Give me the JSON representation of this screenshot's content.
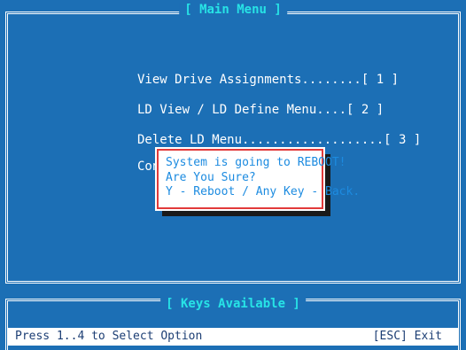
{
  "main_menu": {
    "title": "[ Main Menu ]",
    "items": [
      {
        "label": "View Drive Assignments........[ 1 ]"
      },
      {
        "label": "LD View / LD Define Menu....[ 2 ]"
      },
      {
        "label": "Delete LD Menu...................[ 3 ]"
      },
      {
        "label": "Con"
      }
    ]
  },
  "dialog": {
    "line1": "System is going to REBOOT!",
    "line2": "Are You Sure?",
    "line3": "Y - Reboot / Any Key - Back."
  },
  "keys_panel": {
    "title": "[ Keys Available ]"
  },
  "status_bar": {
    "left_text": "Press 1..4 to Select Option",
    "right_text": "[ESC] Exit"
  },
  "colors": {
    "background": "#1c6fb5",
    "title_accent": "#27e3e6",
    "dialog_border": "#e23a3a",
    "dialog_text": "#1c8be0"
  }
}
